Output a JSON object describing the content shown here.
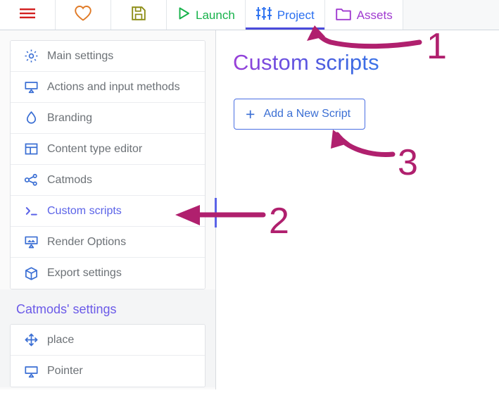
{
  "toolbar": {
    "items": [
      {
        "label": "",
        "icon": "hamburger-menu-icon",
        "name": "menu-button",
        "color": "#d32020",
        "icon_only": true,
        "active": false
      },
      {
        "label": "",
        "icon": "heart-icon",
        "name": "favorites-button",
        "color": "#e07a26",
        "icon_only": true,
        "active": false
      },
      {
        "label": "",
        "icon": "save-floppy-icon",
        "name": "save-button",
        "color": "#8c8c14",
        "icon_only": true,
        "active": false
      },
      {
        "label": "Launch",
        "icon": "play-triangle-icon",
        "name": "launch-tab",
        "color": "#16b24a",
        "icon_only": false,
        "active": false
      },
      {
        "label": "Project",
        "icon": "sliders-icon",
        "name": "project-tab",
        "color": "#2a6ff0",
        "icon_only": false,
        "active": true
      },
      {
        "label": "Assets",
        "icon": "folder-icon",
        "name": "assets-tab",
        "color": "#a03ad0",
        "icon_only": false,
        "active": false
      }
    ]
  },
  "sidebar": {
    "items": [
      {
        "label": "Main settings",
        "icon": "gear-icon",
        "selected": false
      },
      {
        "label": "Actions and input methods",
        "icon": "screen-input-icon",
        "selected": false
      },
      {
        "label": "Branding",
        "icon": "droplet-icon",
        "selected": false
      },
      {
        "label": "Content type editor",
        "icon": "layout-panel-icon",
        "selected": false
      },
      {
        "label": "Catmods",
        "icon": "share-nodes-icon",
        "selected": false
      },
      {
        "label": "Custom scripts",
        "icon": "terminal-prompt-icon",
        "selected": true
      },
      {
        "label": "Render Options",
        "icon": "image-screen-icon",
        "selected": false
      },
      {
        "label": "Export settings",
        "icon": "package-box-icon",
        "selected": false
      }
    ],
    "catmods_section": {
      "title": "Catmods' settings",
      "items": [
        {
          "label": "place",
          "icon": "move-arrows-icon",
          "selected": false
        },
        {
          "label": "Pointer",
          "icon": "screen-input-icon",
          "selected": false
        }
      ]
    }
  },
  "main": {
    "title": "Custom scripts",
    "add_button_label": "Add a New Script",
    "add_button_icon": "plus-icon"
  },
  "annotations": {
    "markers": [
      {
        "number": "1",
        "target": "project-tab",
        "style": "curved-arrow-up-left"
      },
      {
        "number": "2",
        "target": "sidebar-item-custom-scripts",
        "style": "straight-arrow-left"
      },
      {
        "number": "3",
        "target": "add-script-button",
        "style": "curved-arrow-up-left"
      }
    ],
    "ink_color": "#b0206e"
  },
  "colors": {
    "accent_blue": "#3b6fd4",
    "selected_purple": "#5b63e8",
    "annotation": "#b0206e",
    "title_gradient_start": "#9a3fd8",
    "title_gradient_end": "#3b74e8"
  }
}
